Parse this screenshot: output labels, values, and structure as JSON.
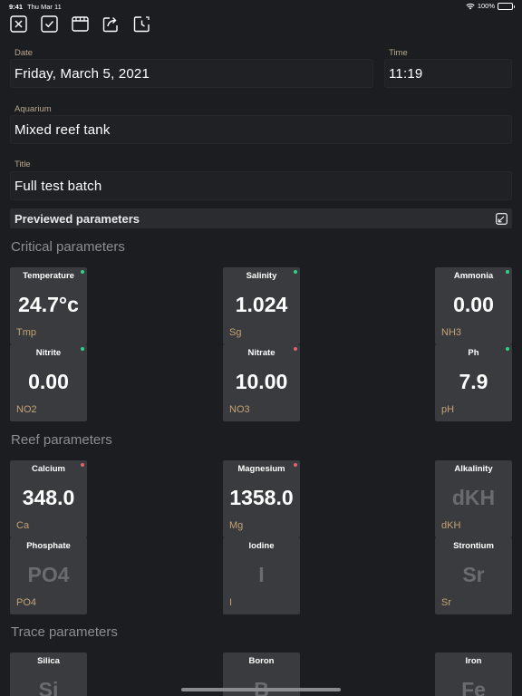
{
  "status": {
    "time": "9:41",
    "date": "Thu Mar 11",
    "battery": "100%"
  },
  "toolbar": {
    "icons": [
      "close-icon",
      "checkmark-icon",
      "calendar-icon",
      "share-icon",
      "reminder-clock-icon"
    ]
  },
  "form": {
    "date_label": "Date",
    "date_value": "Friday, March 5, 2021",
    "time_label": "Time",
    "time_value": "11:19",
    "aquarium_label": "Aquarium",
    "aquarium_value": "Mixed reef tank",
    "title_label": "Title",
    "title_value": "Full test batch"
  },
  "preview": {
    "label": "Previewed parameters"
  },
  "sections": [
    {
      "title": "Critical parameters",
      "tiles": [
        {
          "name": "Temperature",
          "value": "24.7°c",
          "abbr": "Tmp",
          "placeholder": false,
          "status": "green"
        },
        {
          "name": "Salinity",
          "value": "1.024",
          "abbr": "Sg",
          "placeholder": false,
          "status": "green"
        },
        {
          "name": "Ammonia",
          "value": "0.00",
          "abbr": "NH3",
          "placeholder": false,
          "status": "green"
        },
        {
          "name": "Nitrite",
          "value": "0.00",
          "abbr": "NO2",
          "placeholder": false,
          "status": "green"
        },
        {
          "name": "Nitrate",
          "value": "10.00",
          "abbr": "NO3",
          "placeholder": false,
          "status": "red"
        },
        {
          "name": "Ph",
          "value": "7.9",
          "abbr": "pH",
          "placeholder": false,
          "status": "green"
        }
      ]
    },
    {
      "title": "Reef parameters",
      "tiles": [
        {
          "name": "Calcium",
          "value": "348.0",
          "abbr": "Ca",
          "placeholder": false,
          "status": "red"
        },
        {
          "name": "Magnesium",
          "value": "1358.0",
          "abbr": "Mg",
          "placeholder": false,
          "status": "red"
        },
        {
          "name": "Alkalinity",
          "value": "dKH",
          "abbr": "dKH",
          "placeholder": true,
          "status": "none"
        },
        {
          "name": "Phosphate",
          "value": "PO4",
          "abbr": "PO4",
          "placeholder": true,
          "status": "none"
        },
        {
          "name": "Iodine",
          "value": "I",
          "abbr": "I",
          "placeholder": true,
          "status": "none"
        },
        {
          "name": "Strontium",
          "value": "Sr",
          "abbr": "Sr",
          "placeholder": true,
          "status": "none"
        }
      ]
    },
    {
      "title": "Trace parameters",
      "tiles": [
        {
          "name": "Silica",
          "value": "Si",
          "abbr": "",
          "placeholder": true,
          "status": "none"
        },
        {
          "name": "Boron",
          "value": "B",
          "abbr": "",
          "placeholder": true,
          "status": "none"
        },
        {
          "name": "Iron",
          "value": "Fe",
          "abbr": "",
          "placeholder": true,
          "status": "none"
        }
      ]
    }
  ],
  "colors": {
    "background": "#1c1d21",
    "tile": "#3a3b3f",
    "label": "#b8a88e",
    "abbr": "#c4a372",
    "ok": "#2fd08a",
    "alert": "#e0636d"
  }
}
